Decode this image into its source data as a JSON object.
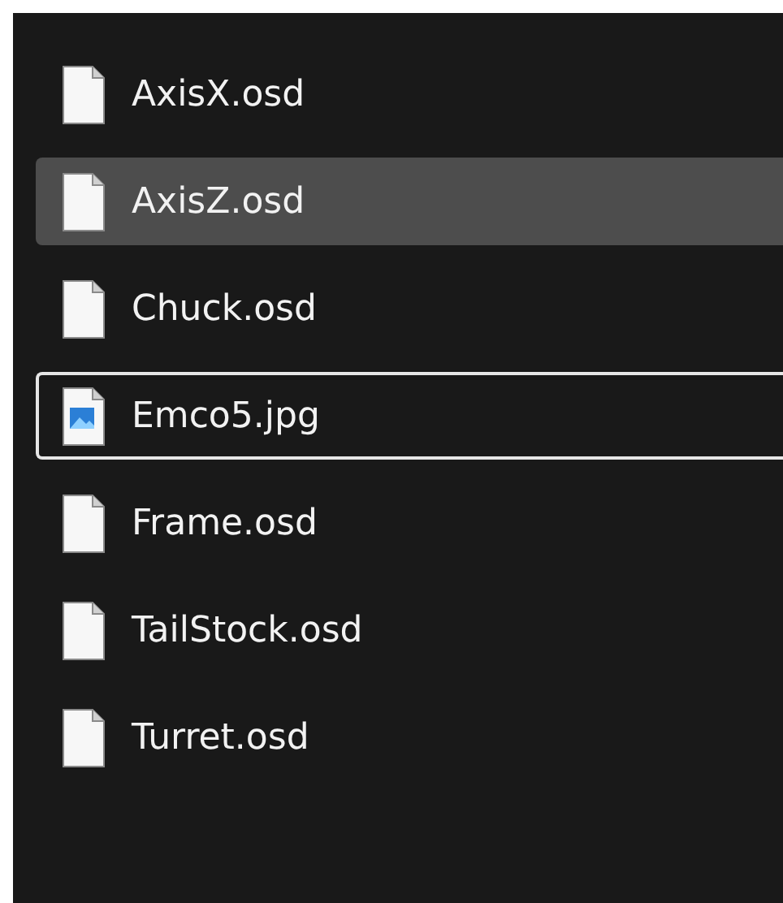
{
  "files": [
    {
      "name": "AxisX.osd",
      "kind": "document",
      "selected": false,
      "focused": false
    },
    {
      "name": "AxisZ.osd",
      "kind": "document",
      "selected": true,
      "focused": false
    },
    {
      "name": "Chuck.osd",
      "kind": "document",
      "selected": false,
      "focused": false
    },
    {
      "name": "Emco5.jpg",
      "kind": "image",
      "selected": false,
      "focused": true
    },
    {
      "name": "Frame.osd",
      "kind": "document",
      "selected": false,
      "focused": false
    },
    {
      "name": "TailStock.osd",
      "kind": "document",
      "selected": false,
      "focused": false
    },
    {
      "name": "Turret.osd",
      "kind": "document",
      "selected": false,
      "focused": false
    }
  ]
}
